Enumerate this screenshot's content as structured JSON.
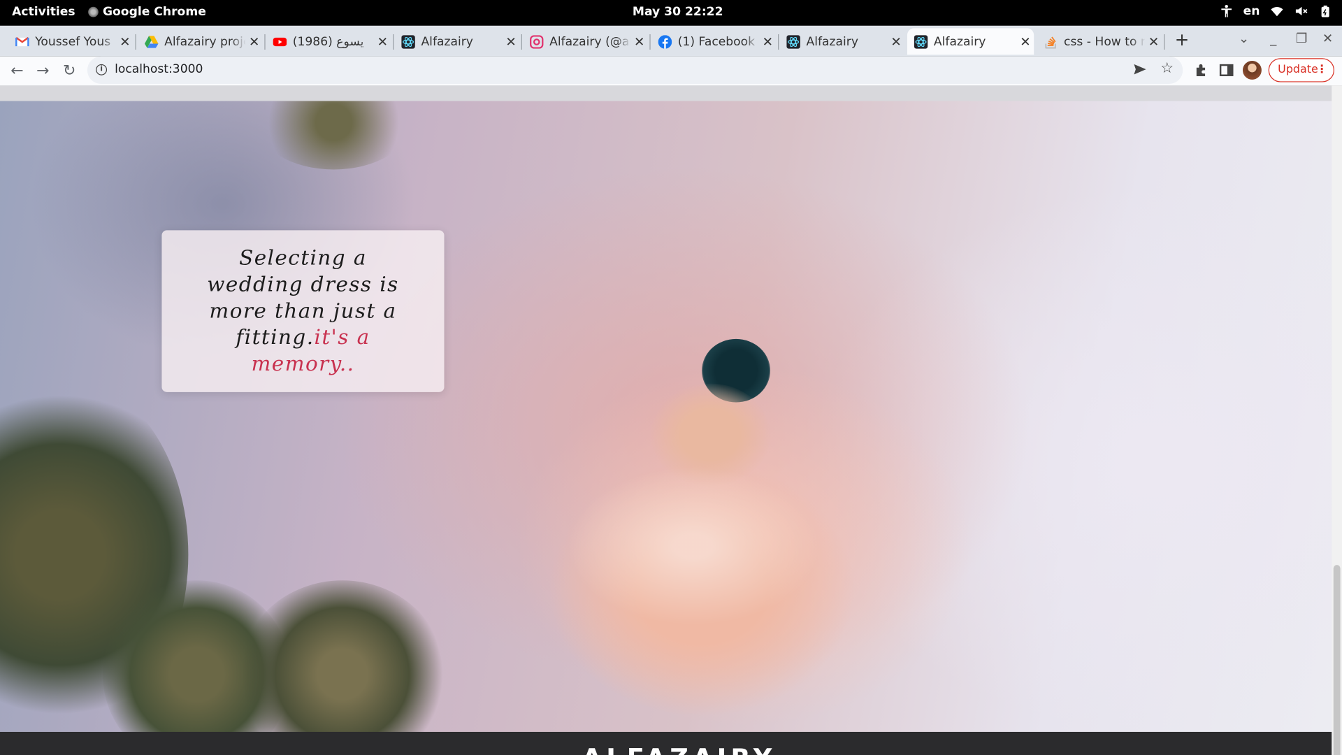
{
  "os_bar": {
    "activities": "Activities",
    "app_name": "Google Chrome",
    "clock": "May 30  22:22",
    "language": "en"
  },
  "tabs": [
    {
      "title": "Youssef Yous",
      "icon": "gmail-icon"
    },
    {
      "title": "Alfazairy proje",
      "icon": "drive-icon"
    },
    {
      "title": "يسوع (1986)",
      "icon": "youtube-icon"
    },
    {
      "title": "Alfazairy",
      "icon": "react-icon"
    },
    {
      "title": "Alfazairy (@al",
      "icon": "instagram-icon"
    },
    {
      "title": "(1) Facebook",
      "icon": "facebook-icon"
    },
    {
      "title": "Alfazairy",
      "icon": "react-icon"
    },
    {
      "title": "Alfazairy",
      "icon": "react-icon",
      "active": true
    },
    {
      "title": "css - How to m",
      "icon": "stackoverflow-icon"
    }
  ],
  "toolbar": {
    "url": "localhost:3000",
    "update_label": "Update"
  },
  "page": {
    "quote_main": "Selecting a wedding dress is more than just a fitting.",
    "quote_accent": "it's a memory..",
    "footer_brand": "ALFAZAIRY"
  },
  "colors": {
    "accent": "#c8314f",
    "footer_bg": "#2b2b2d",
    "update_red": "#d93025"
  }
}
